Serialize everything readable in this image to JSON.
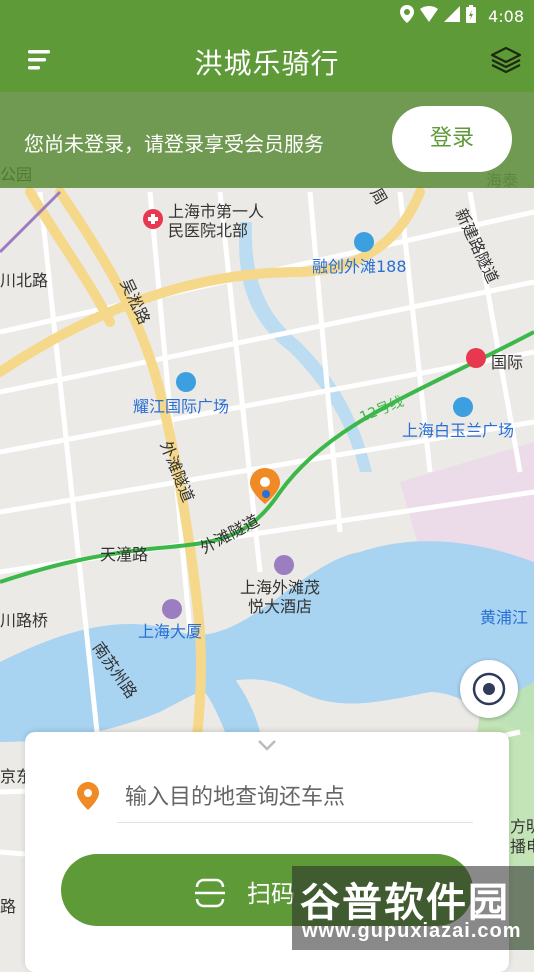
{
  "status_bar": {
    "time": "4:08"
  },
  "header": {
    "title": "洪城乐骑行"
  },
  "banner": {
    "message": "您尚未登录，请登录享受会员服务",
    "login_label": "登录"
  },
  "map_labels": {
    "hospital": "上海市第一人民医院北部",
    "hospital_line1": "上海市第一人",
    "hospital_line2": "民医院北部",
    "rongchuang": "融创外滩188",
    "xinjian_tunnel": "新建路隧道",
    "chuanbei": "川北路",
    "wusong": "吴淞路",
    "guoji": "国际",
    "yaojiang": "耀江国际广场",
    "line12": "12号线",
    "baiyulan": "上海白玉兰广场",
    "waitan_tunnel_v": "外滩隧道",
    "waitan_tunnel": "外滩隧道",
    "tiantong": "天潼路",
    "hotel_line1": "上海外滩茂",
    "hotel_line2": "悦大酒店",
    "huangpu": "黄浦江",
    "chuanlu_bridge": "川路桥",
    "shanghai_mansion": "上海大厦",
    "nansuzhou": "南苏州路",
    "park": "公园",
    "haitai": "海泰",
    "zhou": "周",
    "jingdong": "京东",
    "fangming": "方明",
    "dian": "播电",
    "lu": "路"
  },
  "search": {
    "placeholder": "输入目的地查询还车点"
  },
  "scan": {
    "label": "扫码"
  },
  "watermark": {
    "title": "谷普软件园",
    "url": "www.gupuxiazai.com"
  },
  "colors": {
    "primary": "#5e9a38",
    "metro_line": "#3cb84a",
    "river": "#a8d4f2",
    "marker": "#f08a24"
  }
}
